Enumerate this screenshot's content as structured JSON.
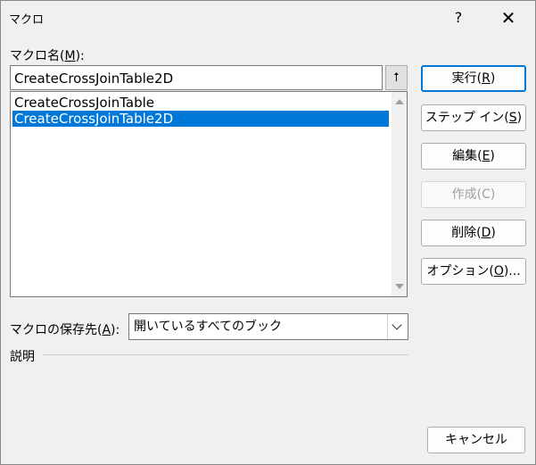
{
  "window": {
    "title": "マクロ",
    "help_label": "?",
    "close_label": "✕"
  },
  "macro_name": {
    "label_prefix": "マクロ名(",
    "label_key": "M",
    "label_suffix": "):",
    "value": "CreateCrossJoinTable2D",
    "up_arrow": "⭡"
  },
  "macro_list": {
    "items": [
      {
        "label": "CreateCrossJoinTable",
        "selected": false
      },
      {
        "label": "CreateCrossJoinTable2D",
        "selected": true
      }
    ]
  },
  "buttons": {
    "run": {
      "prefix": "実行(",
      "key": "R",
      "suffix": ")"
    },
    "step_in": {
      "prefix": "ステップ イン(",
      "key": "S",
      "suffix": ")"
    },
    "edit": {
      "prefix": "編集(",
      "key": "E",
      "suffix": ")"
    },
    "create": {
      "label": "作成(C)"
    },
    "delete": {
      "prefix": "削除(",
      "key": "D",
      "suffix": ")"
    },
    "options": {
      "prefix": "オプション(",
      "key": "O",
      "suffix": ")..."
    },
    "cancel": {
      "label": "キャンセル"
    }
  },
  "location": {
    "label_prefix": "マクロの保存先(",
    "label_key": "A",
    "label_suffix": "):",
    "value": "開いているすべてのブック"
  },
  "description": {
    "label": "説明"
  },
  "colors": {
    "selection": "#0078d7",
    "dialog_bg": "#f0f0f0"
  }
}
